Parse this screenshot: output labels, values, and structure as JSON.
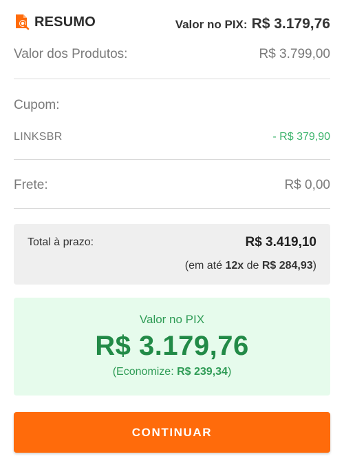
{
  "header": {
    "title": "RESUMO",
    "icon": "receipt-search-icon",
    "pix_label": "Valor no PIX:",
    "pix_value": "R$ 3.179,76"
  },
  "summary": {
    "products_label": "Valor dos Produtos:",
    "products_value": "R$ 3.799,00",
    "coupon_label": "Cupom:",
    "coupon_code": "LINKSBR",
    "coupon_discount": "- R$ 379,90",
    "shipping_label": "Frete:",
    "shipping_value": "R$ 0,00"
  },
  "total": {
    "label": "Total à prazo:",
    "value": "R$ 3.419,10",
    "installments_prefix": "(em até ",
    "installments_count": "12x",
    "installments_middle": " de ",
    "installments_value": "R$ 284,93",
    "installments_suffix": ")"
  },
  "pix": {
    "label": "Valor no PIX",
    "amount": "R$ 3.179,76",
    "savings_prefix": "(Economize: ",
    "savings_value": "R$ 239,34",
    "savings_suffix": ")"
  },
  "actions": {
    "continue_label": "CONTINUAR"
  },
  "colors": {
    "accent": "#ff6b0b",
    "pix_green": "#228a47",
    "pix_background": "#e6fbec",
    "discount_green": "#3bb36b"
  }
}
